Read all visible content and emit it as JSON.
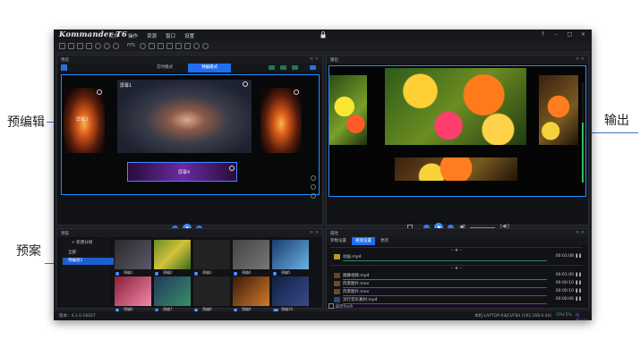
{
  "app": {
    "logo_text": "Kommander T6",
    "menu": [
      "文件",
      "操作",
      "资源",
      "窗口",
      "设置"
    ],
    "fps_label": "FPS"
  },
  "preview": {
    "header": "预览",
    "tabs": [
      "实时模式",
      "预编模式"
    ],
    "center_label": "屏幕1",
    "left_label": "屏幕3",
    "bottom_label": "屏幕4"
  },
  "output": {
    "header": "输出"
  },
  "plan": {
    "header": "预案",
    "new_group": "新建分组",
    "items": [
      "全部",
      "预编组1"
    ],
    "cells": [
      {
        "num": "1",
        "name": "预编1"
      },
      {
        "num": "2",
        "name": "预编2"
      },
      {
        "num": "3",
        "name": "预编3"
      },
      {
        "num": "4",
        "name": "预编4"
      },
      {
        "num": "5",
        "name": "预编5"
      },
      {
        "num": "6",
        "name": "预编6"
      },
      {
        "num": "7",
        "name": "预编7"
      },
      {
        "num": "8",
        "name": "预编8"
      },
      {
        "num": "9",
        "name": "预编9"
      },
      {
        "num": "10",
        "name": "预编10"
      }
    ]
  },
  "properties": {
    "header": "属性",
    "tabs": [
      "参数设置",
      "播放设置",
      "更新"
    ],
    "rows": [
      {
        "name": "动画.mp4",
        "time": "00:01:08"
      },
      {
        "name": "跳舞视频.mp4",
        "time": "00:01:00"
      },
      {
        "name": "风景图片.mov",
        "time": "00:00:10"
      },
      {
        "name": "风景图片.mov",
        "time": "00:00:10"
      },
      {
        "name": "流行音乐素材.mp4",
        "time": "00:00:06"
      }
    ],
    "seek_label": "显示Seek"
  },
  "status": {
    "version": "版本：4.1.0.16027",
    "machine": "本机:LAPTOP-R4JCVF84 (192.168.0.44)",
    "cpu": "CPU:5%",
    "mem": "内存:62%"
  },
  "callouts": {
    "edit": "预编辑",
    "output": "输出",
    "plan": "预案"
  },
  "colors": {
    "accent": "#1f6ef0",
    "frame": "#1f8fff",
    "callout_line": "#3f6fd0"
  }
}
